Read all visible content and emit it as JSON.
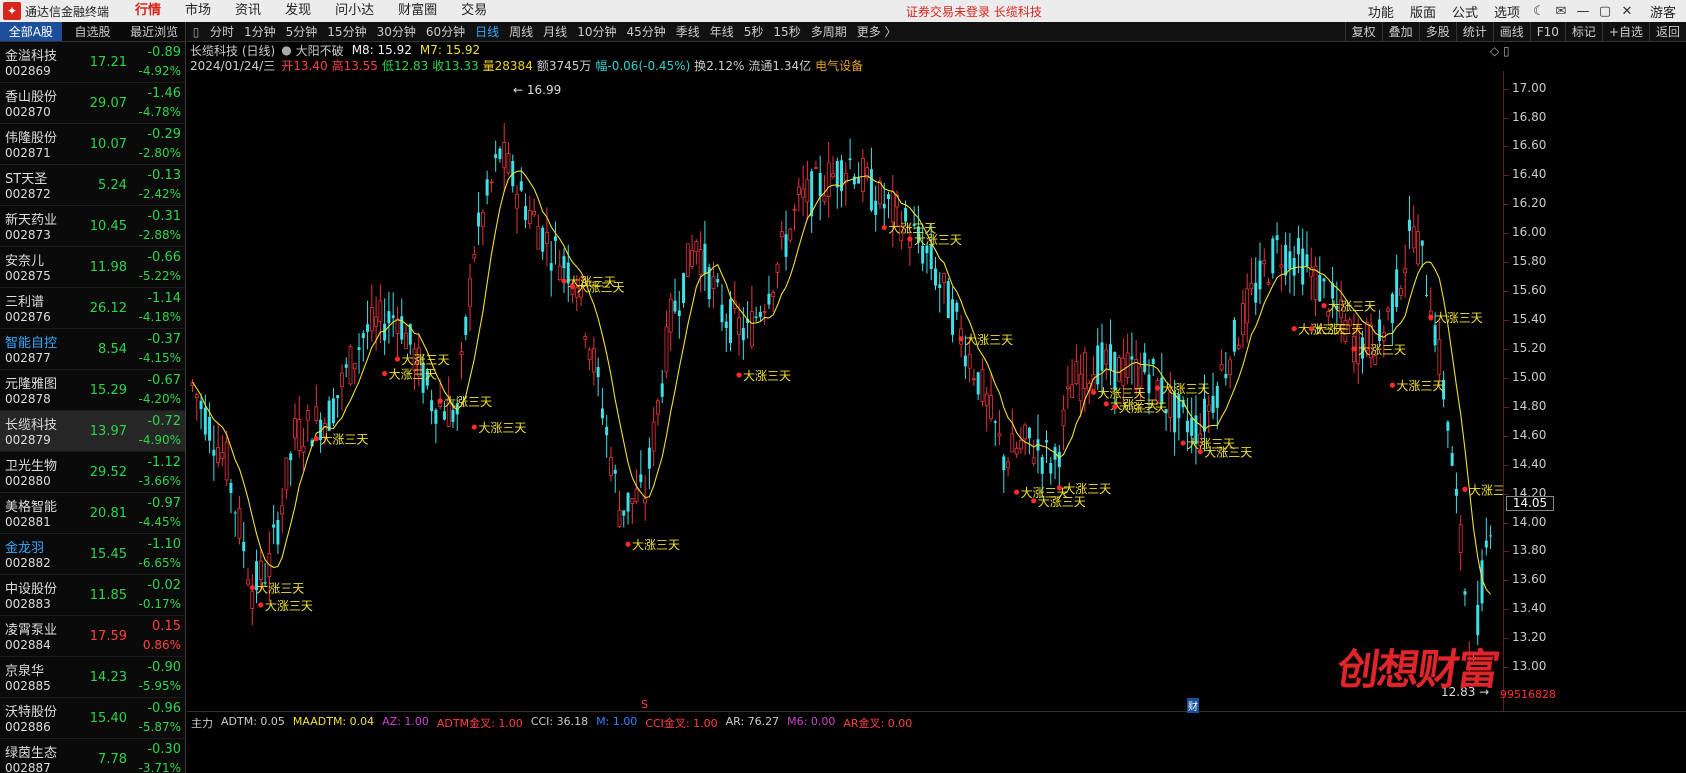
{
  "app": {
    "title": "通达信金融终端",
    "menu": [
      "行情",
      "市场",
      "资讯",
      "发现",
      "问小达",
      "财富圈",
      "交易"
    ],
    "active_menu": "行情",
    "login_notice": "证券交易未登录  长缆科技",
    "top_right": [
      "功能",
      "版面",
      "公式",
      "选项"
    ],
    "guest_label": "游客"
  },
  "sidebar": {
    "tabs": [
      "全部A股",
      "自选股",
      "最近浏览"
    ],
    "stocks": [
      {
        "name": "金溢科技",
        "code": "002869",
        "price": "17.21",
        "change": "-0.89",
        "pct": "-4.92%"
      },
      {
        "name": "香山股份",
        "code": "002870",
        "price": "29.07",
        "change": "-1.46",
        "pct": "-4.78%"
      },
      {
        "name": "伟隆股份",
        "code": "002871",
        "price": "10.07",
        "change": "-0.29",
        "pct": "-2.80%"
      },
      {
        "name": "ST天圣",
        "code": "002872",
        "price": "5.24",
        "change": "-0.13",
        "pct": "-2.42%"
      },
      {
        "name": "新天药业",
        "code": "002873",
        "price": "10.45",
        "change": "-0.31",
        "pct": "-2.88%"
      },
      {
        "name": "安奈儿",
        "code": "002875",
        "price": "11.98",
        "change": "-0.66",
        "pct": "-5.22%"
      },
      {
        "name": "三利谱",
        "code": "002876",
        "price": "26.12",
        "change": "-1.14",
        "pct": "-4.18%"
      },
      {
        "name": "智能自控",
        "code": "002877",
        "price": "8.54",
        "change": "-0.37",
        "pct": "-4.15%"
      },
      {
        "name": "元隆雅图",
        "code": "002878",
        "price": "15.29",
        "change": "-0.67",
        "pct": "-4.20%"
      },
      {
        "name": "长缆科技",
        "code": "002879",
        "price": "13.97",
        "change": "-0.72",
        "pct": "-4.90%"
      },
      {
        "name": "卫光生物",
        "code": "002880",
        "price": "29.52",
        "change": "-1.12",
        "pct": "-3.66%"
      },
      {
        "name": "美格智能",
        "code": "002881",
        "price": "20.81",
        "change": "-0.97",
        "pct": "-4.45%"
      },
      {
        "name": "金龙羽",
        "code": "002882",
        "price": "15.45",
        "change": "-1.10",
        "pct": "-6.65%"
      },
      {
        "name": "中设股份",
        "code": "002883",
        "price": "11.85",
        "change": "-0.02",
        "pct": "-0.17%"
      },
      {
        "name": "凌霄泵业",
        "code": "002884",
        "price": "17.59",
        "change": "0.15",
        "pct": "0.86%"
      },
      {
        "name": "京泉华",
        "code": "002885",
        "price": "14.23",
        "change": "-0.90",
        "pct": "-5.95%"
      },
      {
        "name": "沃特股份",
        "code": "002886",
        "price": "15.40",
        "change": "-0.96",
        "pct": "-5.87%"
      },
      {
        "name": "绿茵生态",
        "code": "002887",
        "price": "7.78",
        "change": "-0.30",
        "pct": "-3.71%"
      }
    ]
  },
  "toolbar": {
    "periods": [
      "分时",
      "1分钟",
      "5分钟",
      "15分钟",
      "30分钟",
      "60分钟",
      "日线",
      "周线",
      "月线",
      "10分钟",
      "45分钟",
      "季线",
      "年线",
      "5秒",
      "15秒",
      "多周期",
      "更多 〉"
    ],
    "active_period": "日线",
    "tools": [
      "复权",
      "叠加",
      "多股",
      "统计",
      "画线",
      "F10",
      "标记",
      "+自选",
      "返回"
    ]
  },
  "chart_info": {
    "title": "长缆科技 (日线)",
    "indicator": "大阳不破",
    "ma8": "M8: 15.92",
    "ma7": "M7: 15.92",
    "date": "2024/01/24/三",
    "open": "开13.40",
    "high": "高13.55",
    "low": "低12.83",
    "close": "收13.33",
    "volume": "量28384",
    "amount": "额3745万",
    "amplitude": "幅-0.06(-0.45%)",
    "turnover": "换2.12%",
    "float": "流通1.34亿",
    "industry": "电气设备"
  },
  "chart_data": {
    "type": "candlestick",
    "y_ticks": [
      "17.00",
      "16.80",
      "16.60",
      "16.40",
      "16.20",
      "16.00",
      "15.80",
      "15.60",
      "15.40",
      "15.20",
      "15.00",
      "14.80",
      "14.60",
      "14.40",
      "14.20",
      "14.00",
      "13.80",
      "13.60",
      "13.40",
      "13.20",
      "13.00"
    ],
    "ylim": [
      12.78,
      17.08
    ],
    "current_price": "14.05",
    "max_label": "16.99",
    "min_label": "12.83",
    "signal_label": "大涨三天",
    "up_color": "#e8323c",
    "down_color": "#3ee0e8",
    "ma_color": "#f0e030",
    "signals": [
      {
        "i": 14,
        "v": 13.55
      },
      {
        "i": 16,
        "v": 13.43
      },
      {
        "i": 29,
        "v": 14.58
      },
      {
        "i": 45,
        "v": 15.03
      },
      {
        "i": 48,
        "v": 15.13
      },
      {
        "i": 58,
        "v": 14.84
      },
      {
        "i": 66,
        "v": 14.66
      },
      {
        "i": 87,
        "v": 15.67
      },
      {
        "i": 89,
        "v": 15.63
      },
      {
        "i": 102,
        "v": 13.85
      },
      {
        "i": 128,
        "v": 15.02
      },
      {
        "i": 162,
        "v": 16.04
      },
      {
        "i": 168,
        "v": 15.96
      },
      {
        "i": 180,
        "v": 15.27
      },
      {
        "i": 193,
        "v": 14.21
      },
      {
        "i": 197,
        "v": 14.15
      },
      {
        "i": 203,
        "v": 14.24
      },
      {
        "i": 211,
        "v": 14.9
      },
      {
        "i": 214,
        "v": 14.82
      },
      {
        "i": 216,
        "v": 14.8
      },
      {
        "i": 226,
        "v": 14.93
      },
      {
        "i": 232,
        "v": 14.55
      },
      {
        "i": 236,
        "v": 14.49
      },
      {
        "i": 258,
        "v": 15.34
      },
      {
        "i": 265,
        "v": 15.5
      },
      {
        "i": 262,
        "v": 15.34
      },
      {
        "i": 272,
        "v": 15.2
      },
      {
        "i": 281,
        "v": 14.95
      },
      {
        "i": 290,
        "v": 15.42
      },
      {
        "i": 298,
        "v": 14.23
      }
    ]
  },
  "bottom": {
    "marker_s": "S",
    "marker_cai": "财",
    "indicators": [
      {
        "text": "主力",
        "color": "#cccccc"
      },
      {
        "text": "ADTM: 0.05",
        "color": "#cccccc"
      },
      {
        "text": "MAADTM: 0.04",
        "color": "#f0e030"
      },
      {
        "text": "AZ: 1.00",
        "color": "#d040d0"
      },
      {
        "text": "ADTM金叉: 1.00",
        "color": "#ff4040"
      },
      {
        "text": "CCI: 36.18",
        "color": "#cccccc"
      },
      {
        "text": "M: 1.00",
        "color": "#3080ff"
      },
      {
        "text": "CCI金叉: 1.00",
        "color": "#ff4040"
      },
      {
        "text": "AR: 76.27",
        "color": "#cccccc"
      },
      {
        "text": "M6: 0.00",
        "color": "#d040d0"
      },
      {
        "text": "AR金叉: 0.00",
        "color": "#ff4040"
      }
    ]
  },
  "watermark": {
    "text": "创想财富",
    "phone": "99516828"
  }
}
